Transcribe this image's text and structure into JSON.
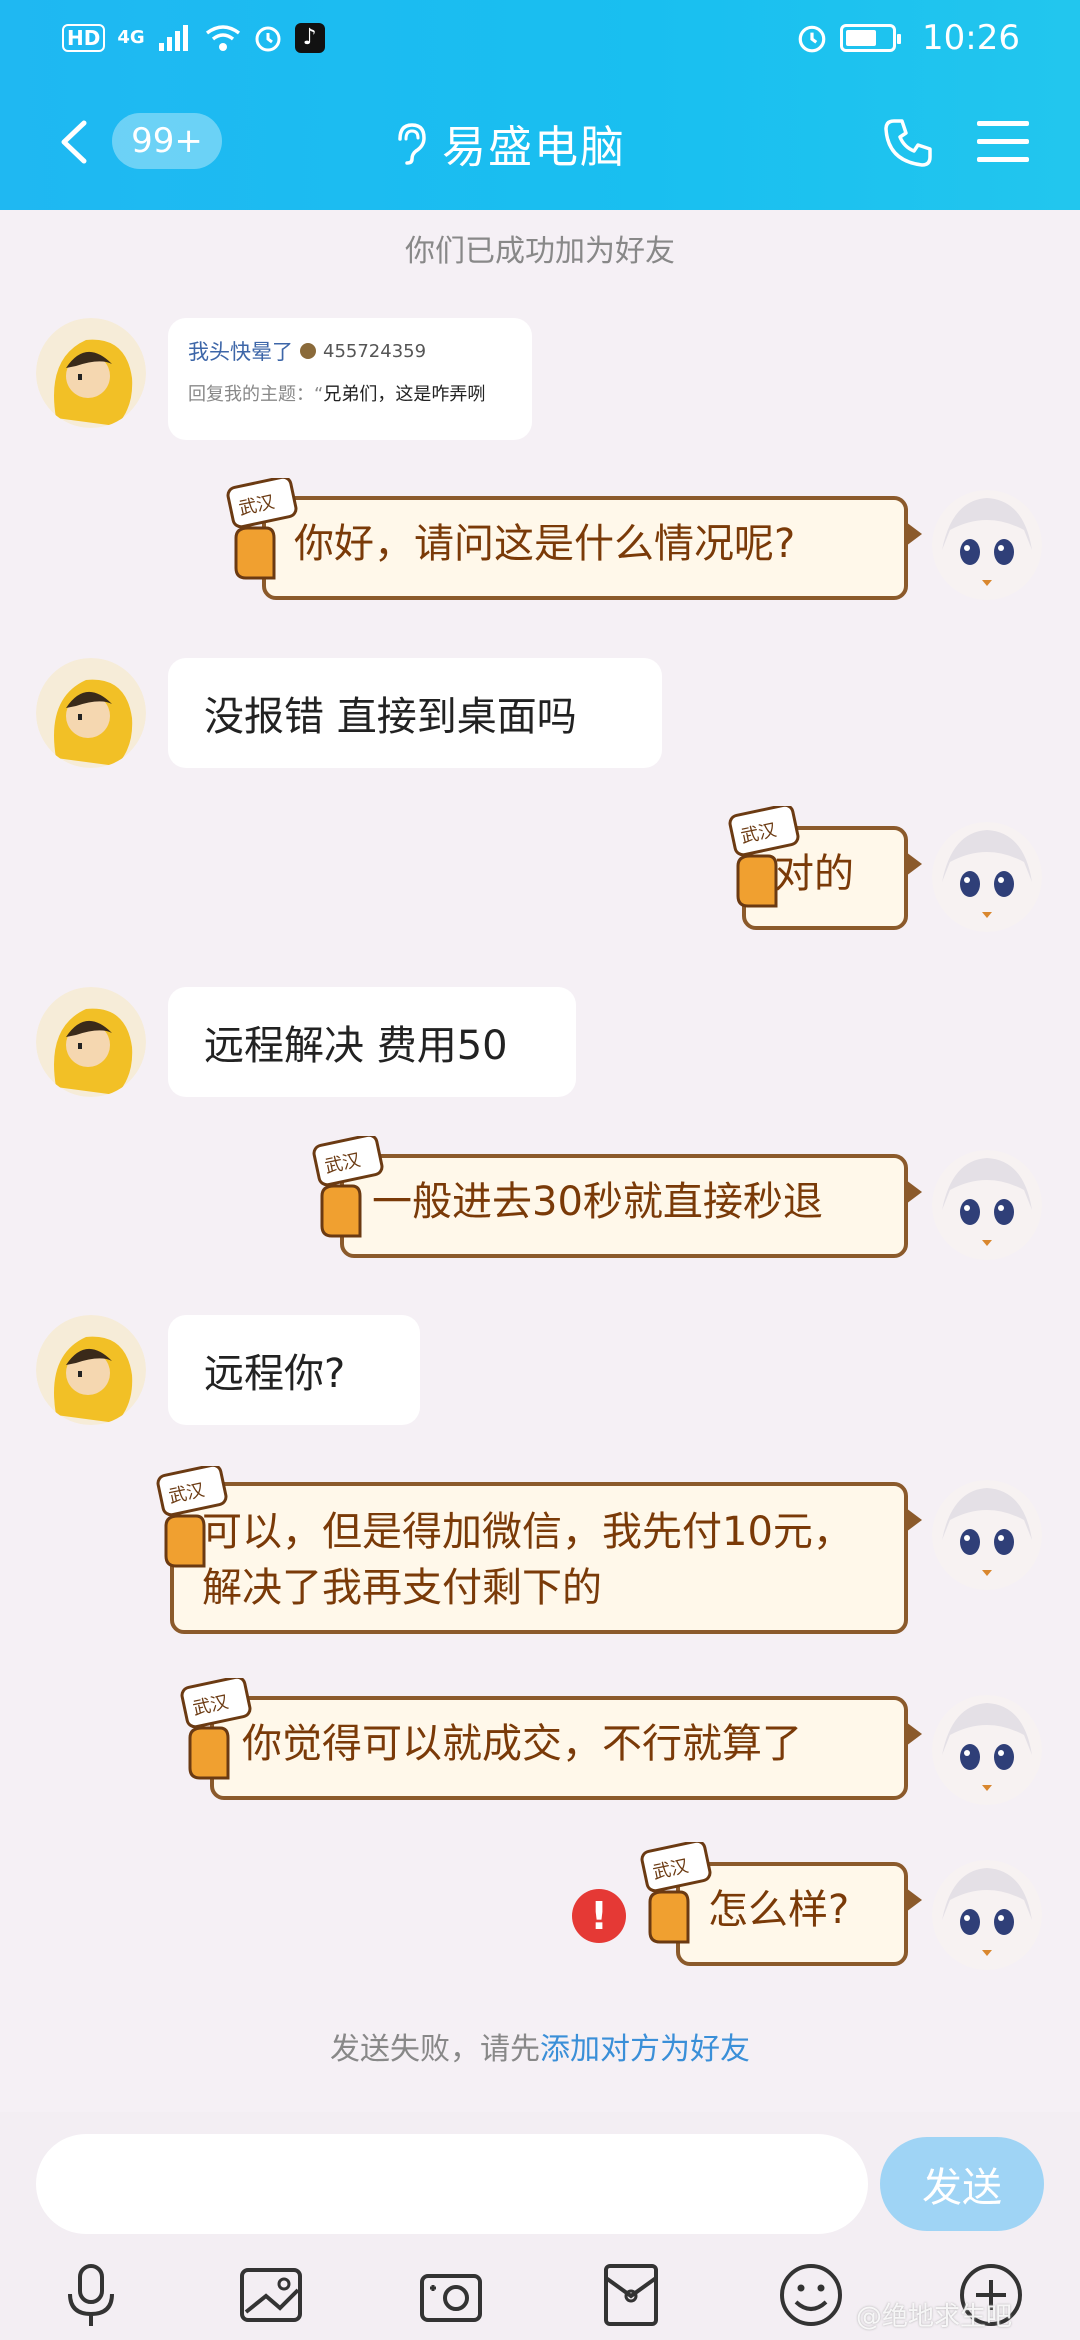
{
  "status_bar": {
    "left_chip": "HD",
    "signal": "4G",
    "time": "10:26"
  },
  "header": {
    "unread_badge": "99+",
    "title": "易盛电脑"
  },
  "system_top": "你们已成功加为好友",
  "quote_card": {
    "line1_text": "我头快晕了",
    "line1_number": "455724359",
    "line2_prefix": "回复我的主题：“",
    "line2_text": "兄弟们，这是咋弄咧"
  },
  "messages": [
    {
      "from": "self",
      "text": "你好，请问这是什么情况呢?"
    },
    {
      "from": "other",
      "text": "没报错 直接到桌面吗"
    },
    {
      "from": "self",
      "text": "对的"
    },
    {
      "from": "other",
      "text": "远程解决 费用50"
    },
    {
      "from": "self",
      "text": "一般进去30秒就直接秒退"
    },
    {
      "from": "other",
      "text": "远程你?"
    },
    {
      "from": "self",
      "text": "可以，但是得加微信，我先付10元，解决了我再支付剩下的"
    },
    {
      "from": "self",
      "text": "你觉得可以就成交，不行就算了"
    },
    {
      "from": "self",
      "text": "怎么样?"
    }
  ],
  "error_mark": "!",
  "system_bottom": {
    "prefix": "发送失败，请先",
    "link": "添加对方为好友"
  },
  "input": {
    "placeholder": "",
    "send_label": "发送"
  },
  "toolbar_icons": [
    "microphone-icon",
    "picture-icon",
    "camera-icon",
    "red-packet-icon",
    "emoji-icon",
    "plus-icon"
  ],
  "watermark": "@绝地求生吧",
  "colors": {
    "header": "#1fb8f2",
    "self_bubble_bg": "#fff8ea",
    "self_bubble_border": "#8b5a2b",
    "self_text": "#7a3a08",
    "send_button": "#9fd4f5",
    "link": "#3a8fd8",
    "error": "#e53935"
  }
}
